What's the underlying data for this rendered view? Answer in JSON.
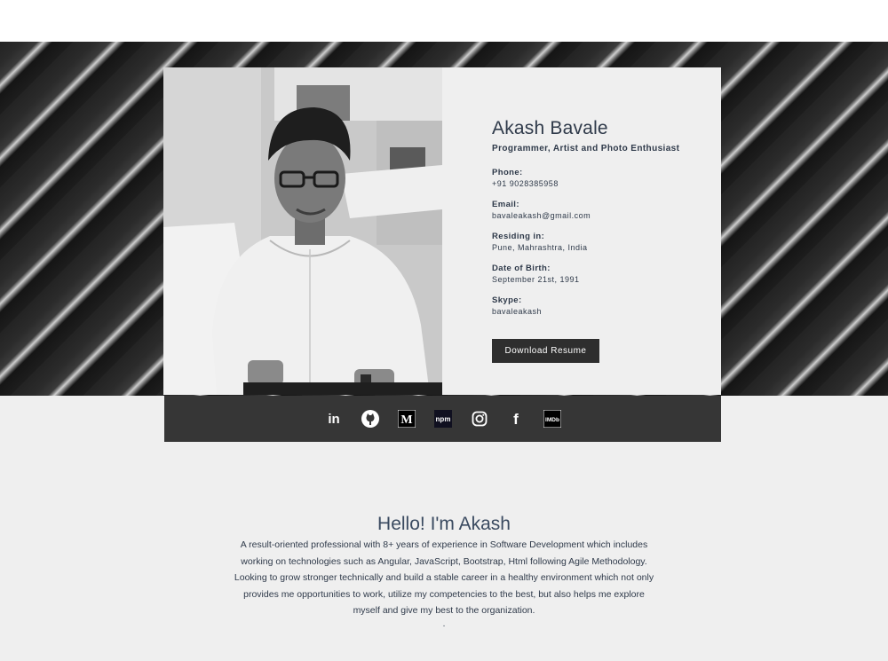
{
  "profile": {
    "name": "Akash Bavale",
    "tagline": "Programmer, Artist and Photo Enthusiast",
    "fields": [
      {
        "label": "Phone:",
        "value": "+91 9028385958"
      },
      {
        "label": "Email:",
        "value": "bavaleakash@gmail.com"
      },
      {
        "label": "Residing in:",
        "value": "Pune, Mahrashtra, India"
      },
      {
        "label": "Date of Birth:",
        "value": "September 21st, 1991"
      },
      {
        "label": "Skype:",
        "value": "bavaleakash"
      }
    ],
    "download_label": "Download Resume"
  },
  "social": [
    {
      "icon": "linkedin-icon",
      "glyph": "in"
    },
    {
      "icon": "github-icon",
      "glyph": ""
    },
    {
      "icon": "medium-icon",
      "glyph": "M"
    },
    {
      "icon": "npm-icon",
      "glyph": "npm"
    },
    {
      "icon": "instagram-icon",
      "glyph": ""
    },
    {
      "icon": "facebook-icon",
      "glyph": "f"
    },
    {
      "icon": "imdb-icon",
      "glyph": "IMDb"
    }
  ],
  "about": {
    "title": "Hello! I'm Akash",
    "lines": [
      "A result-oriented professional with 8+ years of experience in Software Development which includes",
      "working on technologies such as Angular, JavaScript, Bootstrap, Html following Agile Methodology.",
      "Looking to grow stronger technically and build a stable career in a healthy environment which not only",
      "provides me opportunities to work, utilize my competencies to the best, but also helps me explore",
      "myself and give my best to the organization."
    ],
    "trailing": "."
  },
  "colors": {
    "card_bg": "#efefef",
    "button_bg": "#2e2e2e",
    "social_bar_bg": "#363636",
    "text": "#2f3a4a"
  }
}
